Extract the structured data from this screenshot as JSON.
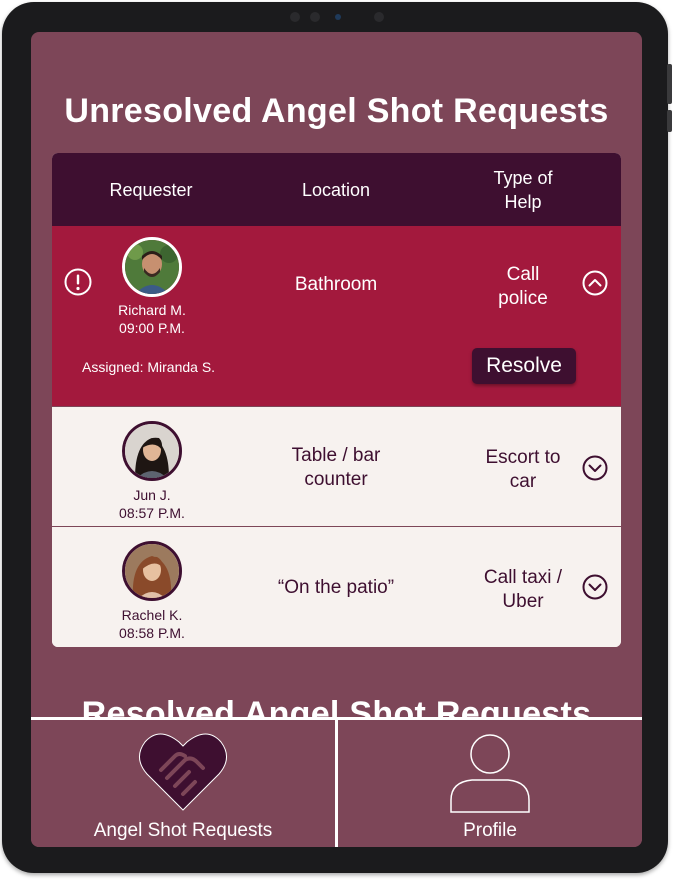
{
  "page": {
    "title": "Unresolved Angel Shot Requests",
    "resolved_title": "Resolved Angel Shot Requests"
  },
  "table": {
    "headers": [
      "Requester",
      "Location",
      "Type of Help"
    ],
    "rows": [
      {
        "name": "Richard M.",
        "time": "09:00 P.M.",
        "location": "Bathroom",
        "type_line1": "Call",
        "type_line2": "police",
        "expanded": true,
        "assigned": "Assigned: Miranda S.",
        "resolve_label": "Resolve"
      },
      {
        "name": "Jun J.",
        "time": "08:57 P.M.",
        "location_line1": "Table / bar",
        "location_line2": "counter",
        "type_line1": "Escort to",
        "type_line2": "car",
        "expanded": false
      },
      {
        "name": "Rachel K.",
        "time": "08:58 P.M.",
        "location": "“On the patio”",
        "type_line1": "Call taxi /",
        "type_line2": "Uber",
        "expanded": false
      }
    ]
  },
  "bottom_nav": {
    "items": [
      {
        "label": "Angel Shot Requests",
        "icon": "heart-handshake-icon"
      },
      {
        "label": "Profile",
        "icon": "user-icon"
      }
    ]
  },
  "colors": {
    "screen_bg": "#7d4658",
    "header_bg": "#3e0f30",
    "active_row": "#a3193d",
    "row_bg": "#f7f2ef"
  }
}
